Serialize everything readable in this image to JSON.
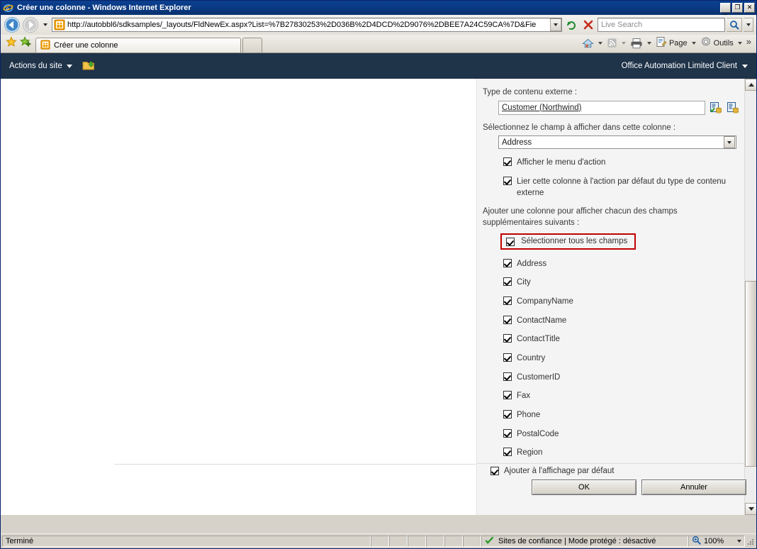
{
  "window": {
    "title": "Créer une colonne - Windows Internet Explorer",
    "icon": "ie-logo-icon",
    "controls": {
      "minimize": "_",
      "maximize": "❐",
      "close": "✕"
    }
  },
  "navbar": {
    "back_icon": "back-arrow-icon",
    "forward_icon": "forward-arrow-icon",
    "history_icon": "chevron-down-icon",
    "address_icon": "page-favicon",
    "address_value": "http://autobbl6/sdksamples/_layouts/FldNewEx.aspx?List=%7B27830253%2D036B%2D4DCD%2D9076%2DBEE7A24C59CA%7D&Fie",
    "refresh_icon": "refresh-icon",
    "stop_icon": "stop-icon",
    "search_placeholder": "Live Search",
    "search_value": "",
    "search_icon": "magnifier-icon",
    "search_drop_icon": "chevron-down-icon"
  },
  "tabbar": {
    "favorites_icon": "star-icon",
    "add_favorite_icon": "add-favorite-icon",
    "tabs": [
      {
        "label": "Créer une colonne",
        "icon": "page-favicon",
        "active": true
      }
    ],
    "new_tab_label": "",
    "commands": {
      "home": "home-icon",
      "feeds": "rss-icon",
      "print": "print-icon",
      "page_label": "Page",
      "page_icon": "page-menu-icon",
      "tools_label": "Outils",
      "tools_icon": "gear-icon",
      "overflow": "»"
    }
  },
  "sharepoint": {
    "site_actions_label": "Actions du site",
    "site_actions_caret": "caret-down-icon",
    "edit_page_icon": "edit-folder-icon",
    "user_label": "Office Automation Limited Client",
    "user_caret": "caret-down-icon"
  },
  "form": {
    "ect_label": "Type de contenu externe :",
    "ect_value": "Customer (Northwind)",
    "ect_picker_icon": "check-entity-icon",
    "ect_browse_icon": "browse-entity-icon",
    "field_label": "Sélectionnez le champ à afficher dans cette colonne :",
    "field_value": "Address",
    "field_dropdown_icon": "chevron-down-icon",
    "show_action_menu_label": "Afficher le menu d'action",
    "show_action_menu_checked": true,
    "link_default_action_label": "Lier cette colonne à l'action par défaut du type de contenu externe",
    "link_default_action_checked": true,
    "add_columns_text": "Ajouter une colonne pour afficher chacun des champs supplémentaires suivants :",
    "select_all_label": "Sélectionner tous les champs",
    "select_all_checked": true,
    "select_all_highlight_color": "#c00000",
    "fields": [
      {
        "label": "Address",
        "checked": true
      },
      {
        "label": "City",
        "checked": true
      },
      {
        "label": "CompanyName",
        "checked": true
      },
      {
        "label": "ContactName",
        "checked": true
      },
      {
        "label": "ContactTitle",
        "checked": true
      },
      {
        "label": "Country",
        "checked": true
      },
      {
        "label": "CustomerID",
        "checked": true
      },
      {
        "label": "Fax",
        "checked": true
      },
      {
        "label": "Phone",
        "checked": true
      },
      {
        "label": "PostalCode",
        "checked": true
      },
      {
        "label": "Region",
        "checked": true
      }
    ],
    "add_to_default_view_label": "Ajouter à l'affichage par défaut",
    "add_to_default_view_checked": true,
    "ok_label": "OK",
    "cancel_label": "Annuler"
  },
  "statusbar": {
    "status_text": "Terminé",
    "zone_icon": "trusted-sites-icon",
    "zone_text": "Sites de confiance | Mode protégé : désactivé",
    "zoom_icon": "zoom-icon",
    "zoom_level": "100%",
    "zoom_caret": "caret-down-icon"
  }
}
